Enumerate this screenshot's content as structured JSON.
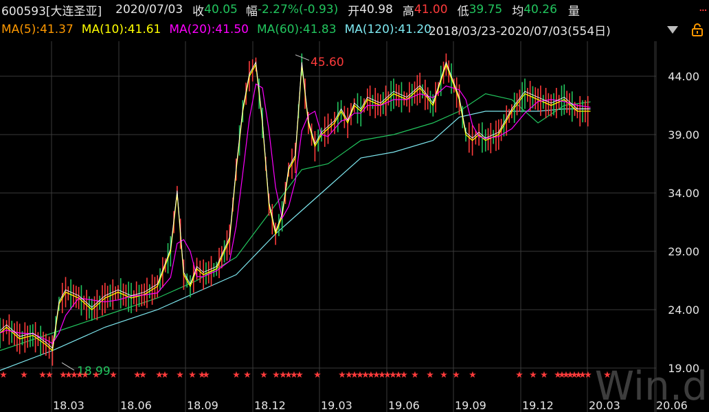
{
  "header": {
    "code_name": "600593[大连圣亚]",
    "date": "2020/07/03",
    "close_label": "收",
    "close_value": "40.05",
    "change_label": "幅",
    "change_value": "-2.27%(-0.93)",
    "open_label": "开",
    "open_value": "40.98",
    "high_label": "高",
    "high_value": "41.00",
    "low_label": "低",
    "low_value": "39.75",
    "avg_label": "均",
    "avg_value": "40.26",
    "vol_label": "量",
    "more_dots": "..."
  },
  "ma_bar": {
    "ma5": "MA(5):41.37",
    "ma10": "MA(10):41.61",
    "ma20": "MA(20):41.50",
    "ma60": "MA(60):41.83",
    "ma120": "MA(120):41.20",
    "range": "2018/03/23-2020/07/03(554日)"
  },
  "watermark": "Win.d",
  "colors": {
    "up": "#ff3b3b",
    "down": "#22c55e",
    "ma5": "#ffffff",
    "ma10": "#ffff00",
    "ma20": "#ff00ff",
    "ma60": "#22c55e",
    "ma120": "#7ee8f0",
    "grid": "#3a3a3a",
    "axis_text": "#e6e6e6"
  },
  "chart_data": {
    "type": "line",
    "ylim": [
      17,
      47
    ],
    "yticks": [
      "44.00",
      "39.00",
      "34.00",
      "29.00",
      "24.00",
      "19.00"
    ],
    "ytick_values": [
      44,
      39,
      34,
      29,
      24,
      19
    ],
    "xticks": [
      "18.03",
      "18.06",
      "18.09",
      "18.12",
      "19.03",
      "19.06",
      "19.09",
      "19.12",
      "20.03",
      "20.06"
    ],
    "annotations": [
      {
        "text": "45.60",
        "value": 45.6,
        "date": "2019/04"
      },
      {
        "text": "18.99",
        "value": 18.99,
        "date": "2018/06"
      }
    ],
    "price_path": {
      "x": [
        0,
        0.01,
        0.03,
        0.05,
        0.07,
        0.08,
        0.09,
        0.1,
        0.12,
        0.14,
        0.16,
        0.18,
        0.2,
        0.22,
        0.24,
        0.26,
        0.27,
        0.28,
        0.29,
        0.3,
        0.31,
        0.33,
        0.35,
        0.36,
        0.37,
        0.38,
        0.39,
        0.4,
        0.41,
        0.42,
        0.43,
        0.44,
        0.45,
        0.46,
        0.47,
        0.48,
        0.49,
        0.5,
        0.51,
        0.52,
        0.53,
        0.54,
        0.55,
        0.56,
        0.58,
        0.6,
        0.62,
        0.64,
        0.66,
        0.68,
        0.7,
        0.71,
        0.72,
        0.73,
        0.74,
        0.76,
        0.78,
        0.8,
        0.82,
        0.84,
        0.86,
        0.88,
        0.9
      ],
      "y": [
        22.0,
        22.5,
        21.5,
        21.8,
        21.0,
        20.5,
        24.5,
        25.5,
        25.0,
        24.0,
        25.0,
        25.5,
        25.0,
        25.3,
        26.0,
        29.0,
        34.0,
        27.0,
        26.0,
        27.5,
        27.0,
        27.5,
        30.0,
        36.0,
        41.0,
        44.0,
        45.0,
        40.0,
        33.0,
        30.5,
        32.0,
        36.0,
        37.0,
        45.0,
        40.0,
        38.0,
        39.0,
        39.5,
        40.0,
        41.0,
        40.0,
        41.5,
        41.0,
        42.0,
        41.5,
        42.5,
        42.0,
        43.0,
        41.5,
        45.0,
        42.0,
        39.0,
        38.5,
        39.0,
        38.5,
        39.0,
        41.0,
        42.5,
        42.0,
        41.5,
        42.0,
        41.0,
        41.0
      ]
    },
    "series": [
      {
        "name": "MA(5)",
        "last": 41.37
      },
      {
        "name": "MA(10)",
        "last": 41.61
      },
      {
        "name": "MA(20)",
        "last": 41.5
      },
      {
        "name": "MA(60)",
        "last": 41.83
      },
      {
        "name": "MA(120)",
        "last": 41.2
      }
    ],
    "ma60_path": {
      "x": [
        0.0,
        0.08,
        0.16,
        0.24,
        0.3,
        0.36,
        0.42,
        0.46,
        0.5,
        0.55,
        0.6,
        0.66,
        0.7,
        0.74,
        0.78,
        0.82,
        0.86,
        0.9
      ],
      "y": [
        20.5,
        22.0,
        23.5,
        25.0,
        26.5,
        28.5,
        33.0,
        36.0,
        36.5,
        38.5,
        39.0,
        40.0,
        41.0,
        42.5,
        42.0,
        40.0,
        41.5,
        41.8
      ]
    },
    "ma120_path": {
      "x": [
        0.0,
        0.08,
        0.16,
        0.24,
        0.3,
        0.36,
        0.42,
        0.46,
        0.5,
        0.55,
        0.6,
        0.66,
        0.7,
        0.74,
        0.78,
        0.82,
        0.86,
        0.9
      ],
      "y": [
        18.8,
        20.5,
        22.5,
        24.0,
        25.5,
        27.0,
        30.5,
        32.5,
        34.5,
        37.0,
        37.5,
        38.5,
        40.5,
        41.0,
        41.0,
        41.0,
        41.2,
        41.2
      ]
    },
    "markers_star_row": "★"
  }
}
